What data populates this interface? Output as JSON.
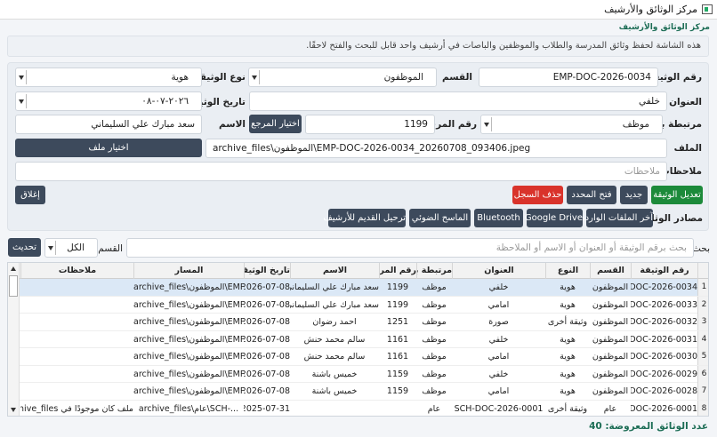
{
  "window": {
    "title": "مركز الوثائق والأرشيف"
  },
  "page": {
    "heading": "مركز الوثائق والأرشيف",
    "description": "هذه الشاشة لحفظ وثائق المدرسة والطلاب والموظفين والباصات في أرشيف واحد قابل للبحث والفتح لاحقًا."
  },
  "form": {
    "doc_number": {
      "label": "رقم الوثيقة",
      "value": "EMP-DOC-2026-0034"
    },
    "section": {
      "label": "القسم",
      "value": "الموظفون"
    },
    "doc_type": {
      "label": "نوع الوثيقة",
      "value": "هوية"
    },
    "title": {
      "label": "العنوان",
      "value": "خلفي"
    },
    "doc_date": {
      "label": "تاريخ الوثيقة",
      "value": "٢٠٢٦-٠٧-٠٨"
    },
    "linked_to": {
      "label": "مرتبطة بـ",
      "value": "موظف"
    },
    "ref_number": {
      "label": "رقم المرجع",
      "value": "1199"
    },
    "choose_ref_label": "اختيار المرجع",
    "name": {
      "label": "الاسم",
      "value": "سعد مبارك علي السليماني"
    },
    "file": {
      "label": "الملف",
      "value": "archive_files\\الموظفون\\EMP-DOC-2026-0034_20260708_093406.jpeg"
    },
    "choose_file_label": "اختيار ملف",
    "notes": {
      "label": "ملاحظات",
      "placeholder": "ملاحظات"
    }
  },
  "actions": {
    "edit": "تعديل الوثيقة",
    "new": "جديد",
    "open": "فتح المحدد",
    "delete": "حذف السجل",
    "close": "إغلاق"
  },
  "sources": {
    "label": "مصادر الوثائق",
    "items": [
      "آخر الملفات الواردة",
      "Google Drive",
      "Bluetooth",
      "الماسح الضوئي",
      "ترحيل القديم للأرشيف"
    ]
  },
  "search": {
    "label": "بحث",
    "placeholder": "بحث برقم الوثيقة أو العنوان أو الاسم أو الملاحظة",
    "section_label": "القسم",
    "section_value": "الكل",
    "refresh": "تحديث"
  },
  "table": {
    "columns": [
      "رقم الوثيقة",
      "القسم",
      "النوع",
      "العنوان",
      "مرتبطة بـ",
      "رقم المرجع",
      "الاسم",
      "تاريخ الوثيقة",
      "المسار",
      "ملاحظات"
    ],
    "rows": [
      {
        "num": "1",
        "cells": [
          "EMP-DOC-2026-0034",
          "الموظفون",
          "هوية",
          "خلفي",
          "موظف",
          "1199",
          "سعد مبارك علي السليماني",
          "2026-07-08",
          "archive_files\\الموظفون\\EMP-...",
          ""
        ]
      },
      {
        "num": "2",
        "cells": [
          "EMP-DOC-2026-0033",
          "الموظفون",
          "هوية",
          "امامي",
          "موظف",
          "1199",
          "سعد مبارك علي السليماني",
          "2026-07-08",
          "archive_files\\الموظفون\\EMP-...",
          ""
        ]
      },
      {
        "num": "3",
        "cells": [
          "EMP-DOC-2026-0032",
          "الموظفون",
          "وثيقة أخرى",
          "صورة",
          "موظف",
          "1251",
          "احمد رضوان",
          "2026-07-08",
          "archive_files\\الموظفون\\EMP-...",
          ""
        ]
      },
      {
        "num": "4",
        "cells": [
          "EMP-DOC-2026-0031",
          "الموظفون",
          "هوية",
          "خلفي",
          "موظف",
          "1161",
          "سالم محمد حنش",
          "2026-07-08",
          "archive_files\\الموظفون\\EMP-...",
          ""
        ]
      },
      {
        "num": "5",
        "cells": [
          "EMP-DOC-2026-0030",
          "الموظفون",
          "هوية",
          "امامي",
          "موظف",
          "1161",
          "سالم محمد حنش",
          "2026-07-08",
          "archive_files\\الموظفون\\EMP-...",
          ""
        ]
      },
      {
        "num": "6",
        "cells": [
          "EMP-DOC-2026-0029",
          "الموظفون",
          "هوية",
          "خلفي",
          "موظف",
          "1159",
          "خميس باشنة",
          "2026-07-08",
          "archive_files\\الموظفون\\EMP-...",
          ""
        ]
      },
      {
        "num": "7",
        "cells": [
          "EMP-DOC-2026-0028",
          "الموظفون",
          "هوية",
          "امامي",
          "موظف",
          "1159",
          "خميس باشنة",
          "2026-07-08",
          "archive_files\\الموظفون\\EMP-...",
          ""
        ]
      },
      {
        "num": "8",
        "cells": [
          "SCH-DOC-2026-0001",
          "عام",
          "وثيقة أخرى",
          "SCH-DOC-2026-0001",
          "عام",
          "",
          "",
          "2025-07-31",
          "archive_files\\عام\\SCH-...",
          "ملف كان موجودًا في archive_files ..."
        ]
      }
    ]
  },
  "footer": {
    "count_text": "عدد الوثائق المعروضة: 40"
  }
}
